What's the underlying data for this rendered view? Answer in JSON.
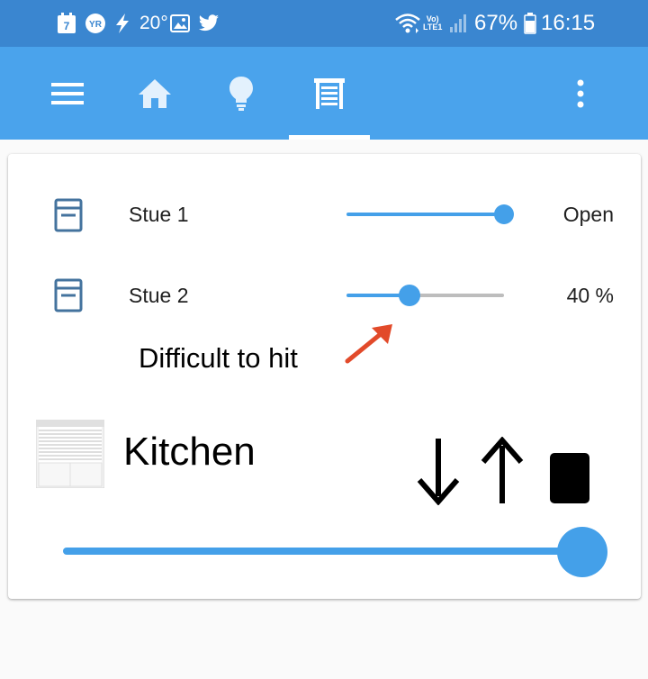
{
  "status_bar": {
    "calendar_day": "7",
    "yr_badge": "YR",
    "temperature": "20°",
    "volte_label_top": "Vo)",
    "volte_label_bottom": "LTE1",
    "battery_percent": "67%",
    "time": "16:15",
    "icons": [
      "calendar-icon",
      "yr-weather-icon",
      "bolt-icon",
      "image-icon",
      "twitter-icon",
      "wifi-icon",
      "cell-signal-icon",
      "battery-icon"
    ]
  },
  "toolbar": {
    "icons": [
      "menu-icon",
      "home-icon",
      "lightbulb-icon",
      "shutter-icon",
      "more-vert-icon"
    ],
    "active_tab": "shutter-icon"
  },
  "rows": [
    {
      "name": "Stue 1",
      "value": "Open",
      "position": 1.0
    },
    {
      "name": "Stue 2",
      "value": "40 %",
      "position": 0.4
    }
  ],
  "annotation": {
    "text": "Difficult to hit",
    "arrow_color": "#e24a2a"
  },
  "kitchen": {
    "title": "Kitchen",
    "position": 1.0,
    "controls": [
      "arrow-down-icon",
      "arrow-up-icon",
      "stop-icon"
    ]
  },
  "colors": {
    "status_bar": "#3a86d0",
    "toolbar": "#4aa3ec",
    "accent": "#44a0e9",
    "track_inactive": "#bdbdbd",
    "row_icon": "#44739e"
  }
}
